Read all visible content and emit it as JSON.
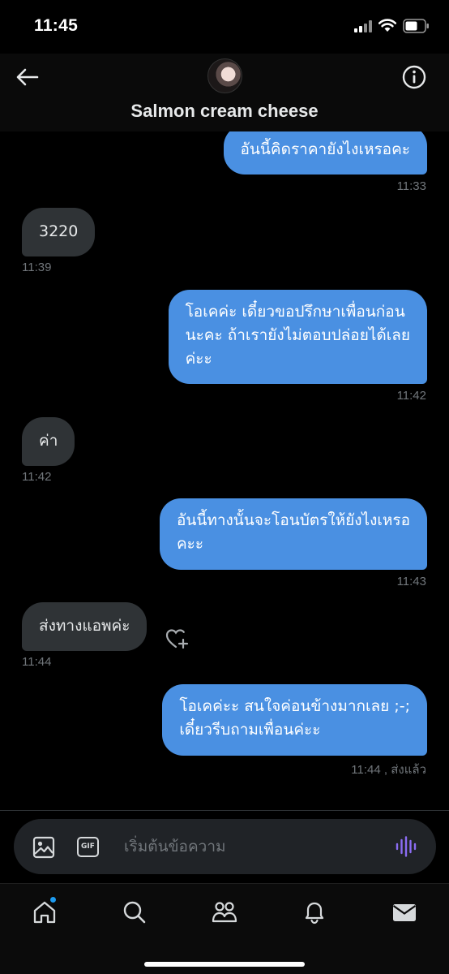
{
  "status_bar": {
    "time": "11:45"
  },
  "header": {
    "title": "Salmon cream cheese"
  },
  "messages": [
    {
      "direction": "out",
      "lines": [
        "อันนี้คิดราคายังไงเหรอคะ"
      ],
      "time": "11:33"
    },
    {
      "direction": "in",
      "lines": [
        "3220"
      ],
      "time": "11:39"
    },
    {
      "direction": "out",
      "lines": [
        "โอเคค่ะ เดี๋ยวขอปรึกษาเพื่อนก่อน",
        "นะคะ ถ้าเรายังไม่ตอบปล่อยได้เลย",
        "ค่ะะ"
      ],
      "time": "11:42"
    },
    {
      "direction": "in",
      "lines": [
        "ค่า"
      ],
      "time": "11:42"
    },
    {
      "direction": "out",
      "lines": [
        "อันนี้ทางนั้นจะโอนบัตรให้ยังไงเหรอ",
        "คะะ"
      ],
      "time": "11:43"
    },
    {
      "direction": "in",
      "lines": [
        "ส่งทางแอพค่ะ"
      ],
      "time": "11:44"
    },
    {
      "direction": "out",
      "lines": [
        "โอเคค่ะะ สนใจค่อนข้างมากเลย ;-;",
        "เดี๋ยวรีบถามเพื่อนค่ะะ"
      ],
      "time": "11:44",
      "status": "ส่งแล้ว"
    }
  ],
  "composer": {
    "gif_label": "GIF",
    "placeholder": "เริ่มต้นข้อความ"
  },
  "icons": {
    "back": "back-arrow-icon",
    "info": "info-icon",
    "media": "image-icon",
    "voice": "voice-wave-icon",
    "react": "add-reaction-icon",
    "nav": [
      "home-icon",
      "search-icon",
      "communities-icon",
      "notifications-icon",
      "messages-icon"
    ]
  },
  "colors": {
    "outgoing_bubble": "#4a90e2",
    "incoming_bubble": "#2f3336",
    "notification_dot": "#1d9bf0",
    "voice_icon": "#8b6cf2"
  }
}
